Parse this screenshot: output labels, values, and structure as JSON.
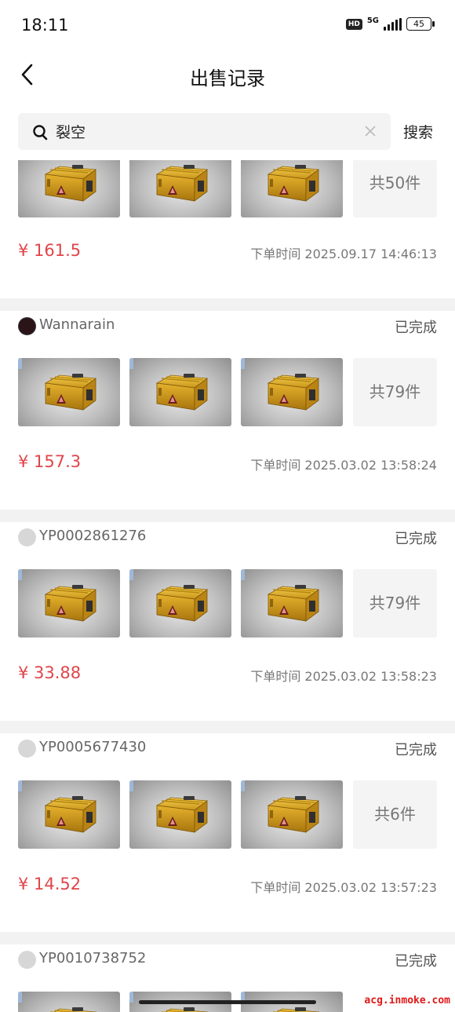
{
  "status_bar": {
    "time": "18:11",
    "hd": "HD",
    "network": "5G",
    "battery": "45"
  },
  "nav": {
    "title": "出售记录",
    "back_icon": "chevron-left-icon"
  },
  "search": {
    "value": "裂空",
    "search_label": "搜索",
    "icon": "search-icon",
    "clear_icon": "close-icon"
  },
  "orders": [
    {
      "user": "",
      "status": "",
      "count_label": "共50件",
      "price": "¥ 161.5",
      "time_label": "下单时间 2025.09.17 14:46:13"
    },
    {
      "user": "Wannarain",
      "status": "已完成",
      "count_label": "共79件",
      "price": "¥ 157.3",
      "time_label": "下单时间 2025.03.02 13:58:24"
    },
    {
      "user": "YP0002861276",
      "status": "已完成",
      "count_label": "共79件",
      "price": "¥ 33.88",
      "time_label": "下单时间 2025.03.02 13:58:23"
    },
    {
      "user": "YP0005677430",
      "status": "已完成",
      "count_label": "共6件",
      "price": "¥ 14.52",
      "time_label": "下单时间 2025.03.02 13:57:23"
    },
    {
      "user": "YP0010738752",
      "status": "已完成",
      "count_label": "",
      "price": "",
      "time_label": ""
    }
  ],
  "watermark": "acg.inmoke.com",
  "colors": {
    "price": "#e0454a",
    "divider": "#f2f2f2"
  }
}
